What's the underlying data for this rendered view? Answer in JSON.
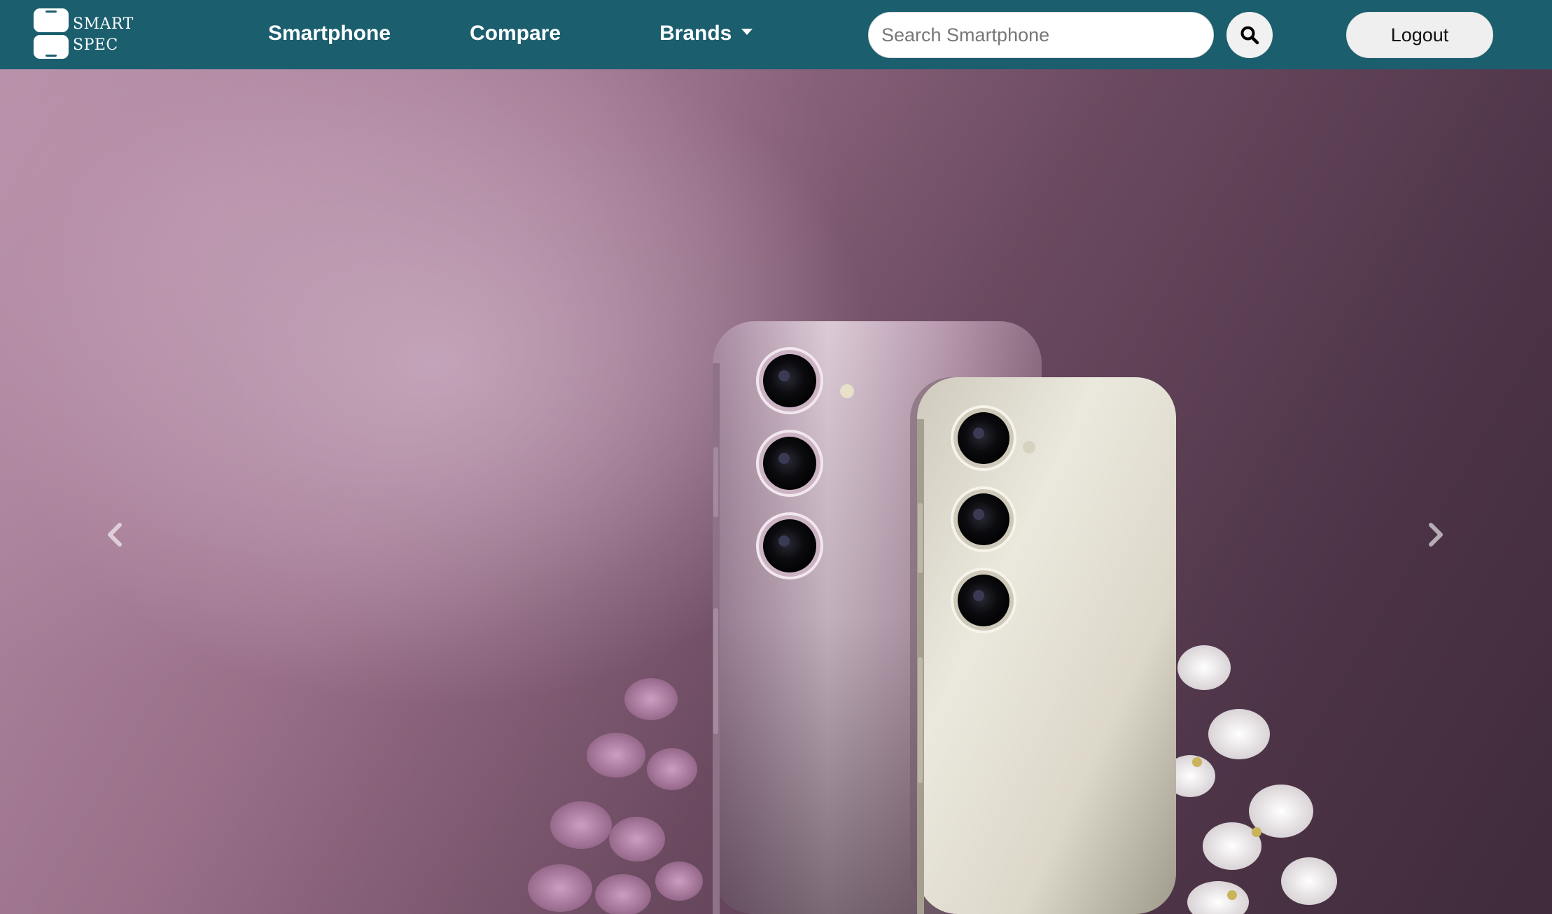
{
  "brand": {
    "logo_line1": "SMART",
    "logo_line2": "SPEC"
  },
  "nav": {
    "items": [
      {
        "label": "Smartphone"
      },
      {
        "label": "Compare"
      },
      {
        "label": "Brands",
        "has_dropdown": true
      }
    ]
  },
  "search": {
    "placeholder": "Search Smartphone",
    "value": "",
    "icon": "search-icon"
  },
  "account": {
    "logout_label": "Logout"
  },
  "carousel": {
    "prev_icon": "chevron-left-icon",
    "next_icon": "chevron-right-icon"
  },
  "colors": {
    "navbar": "#1b5e6e",
    "button_bg": "#efefef",
    "hero_light": "#b58fa6",
    "hero_dark": "#3f2b3a"
  }
}
